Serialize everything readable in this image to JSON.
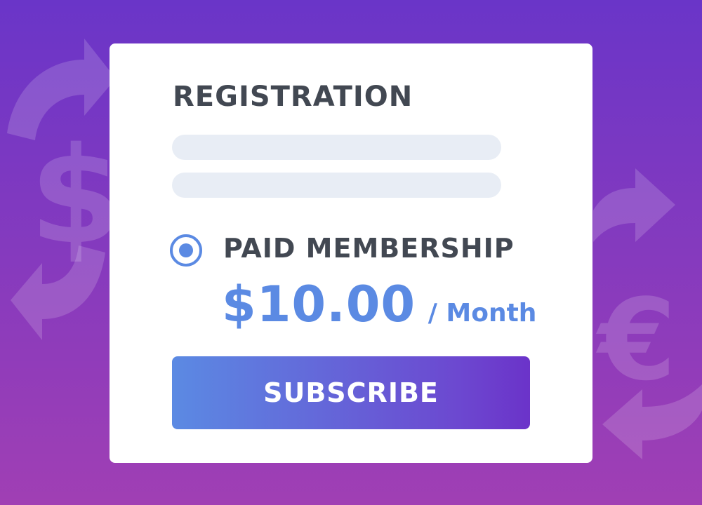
{
  "theme": {
    "bg_top": "#6a35c8",
    "bg_bottom": "#a03fb4",
    "accent": "#5b8ae3",
    "button_gradient_end": "#6b33c9",
    "text_dark": "#424852",
    "field_bg": "#e8edf5"
  },
  "background_icons": [
    "circular-arrows-icon",
    "dollar-icon",
    "euro-icon"
  ],
  "form": {
    "title": "REGISTRATION",
    "fields": [
      {
        "value": "",
        "placeholder": ""
      },
      {
        "value": "",
        "placeholder": ""
      }
    ],
    "plan": {
      "label": "PAID MEMBERSHIP",
      "selected": true,
      "price": "$10.00",
      "period": "/ Month"
    },
    "subscribe_label": "SUBSCRIBE"
  }
}
